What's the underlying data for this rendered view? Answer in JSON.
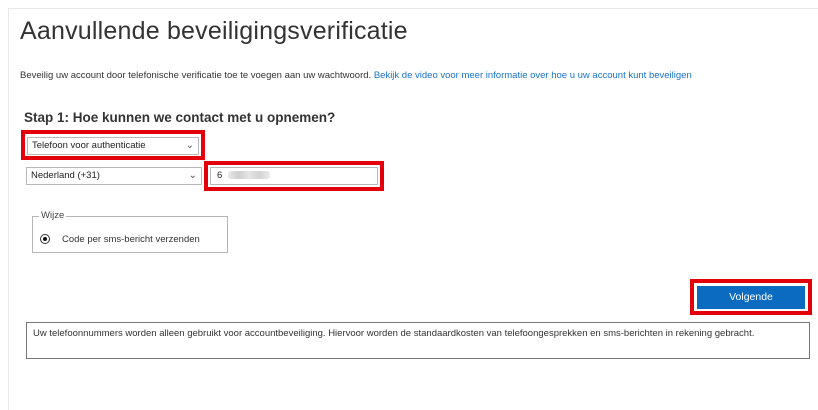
{
  "page": {
    "title": "Aanvullende beveiligingsverificatie",
    "intro_text": "Beveilig uw account door telefonische verificatie toe te voegen aan uw wachtwoord.",
    "intro_link": "Bekijk de video voor meer informatie over hoe u uw account kunt beveiligen"
  },
  "step1": {
    "heading": "Stap 1: Hoe kunnen we contact met u opnemen?",
    "method_select": {
      "value": "Telefoon voor authenticatie"
    },
    "country_select": {
      "value": "Nederland (+31)"
    },
    "phone_input": {
      "value": "6"
    },
    "mode_group": {
      "legend": "Wijze",
      "option_label": "Code per sms-bericht verzenden",
      "selected": true
    }
  },
  "actions": {
    "next_label": "Volgende"
  },
  "notice": "Uw telefoonnummers worden alleen gebruikt voor accountbeveiliging. Hiervoor worden de standaardkosten van telefoongesprekken en sms-berichten in rekening gebracht.",
  "colors": {
    "primary_button": "#0a6bc1",
    "link": "#1a73c9",
    "highlight": "#e3000b"
  },
  "icons": {
    "dropdown": "chevron-down-icon",
    "radio": "radio-selected-icon"
  }
}
